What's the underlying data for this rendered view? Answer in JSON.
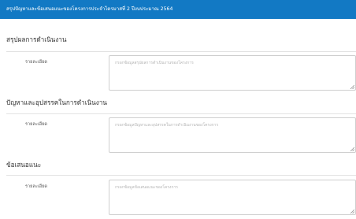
{
  "header": {
    "title": "สรุปปัญหาและข้อเสนอแนะของโครงการประจำไตรมาสที่ 2 ปีงบประมาณ 2564"
  },
  "sections": [
    {
      "title": "สรุปผลการดำเนินงาน",
      "field_label": "รายละเอียด",
      "placeholder": "กรอกข้อมูลสรุปผลการดำเนินงานของโครงการ",
      "value": ""
    },
    {
      "title": "ปัญหาและอุปสรรคในการดำเนินงาน",
      "field_label": "รายละเอียด",
      "placeholder": "กรอกข้อมูลปัญหาและอุปสรรคในการดำเนินงานของโครงการ",
      "value": ""
    },
    {
      "title": "ข้อเสนอแนะ",
      "field_label": "รายละเอียด",
      "placeholder": "กรอกข้อมูลข้อเสนอแนะของโครงการ",
      "value": ""
    }
  ],
  "colors": {
    "header_bg": "#1279c4",
    "header_text": "#ffffff",
    "border": "#cfcfcf",
    "placeholder": "#b4b4b4"
  },
  "icons": {
    "resize": "resize-grip-icon"
  }
}
